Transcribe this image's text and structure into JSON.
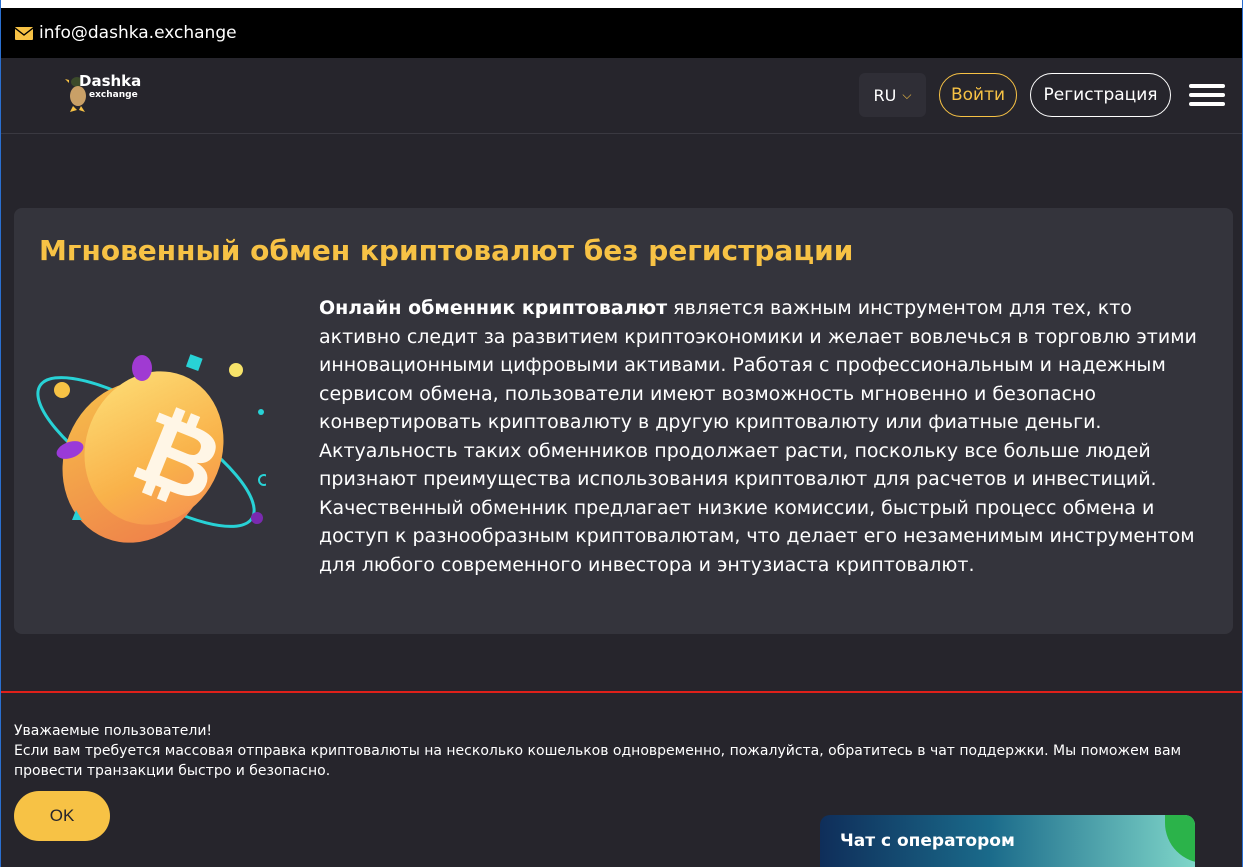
{
  "topbar": {
    "email": "info@dashka.exchange",
    "icon": "mail-icon"
  },
  "header": {
    "logo_line1": "Dashka",
    "logo_line2": "exchange",
    "lang": "RU",
    "login_label": "Войти",
    "register_label": "Регистрация"
  },
  "hero": {
    "title": "Мгновенный обмен криптовалют без регистрации",
    "lead_bold": "Онлайн обменник криптовалют",
    "body": " является важным инструментом для тех, кто активно следит за развитием криптоэкономики и желает вовлечься в торговлю этими инновационными цифровыми активами. Работая с профессиональным и надежным сервисом обмена, пользователи имеют возможность мгновенно и безопасно конвертировать криптовалюту в другую криптовалюту или фиатные деньги. Актуальность таких обменников продолжает расти, поскольку все больше людей признают преимущества использования криптовалют для расчетов и инвестиций. Качественный обменник предлагает низкие комиссии, быстрый процесс обмена и доступ к разнообразным криптовалютам, что делает его незаменимым инструментом для любого современного инвестора и энтузиаста криптовалют."
  },
  "notice": {
    "line1": "Уважаемые пользователи!",
    "line2": "Если вам требуется массовая отправка криптовалюты на несколько кошельков одновременно, пожалуйста, обратитесь в чат поддержки. Мы поможем вам провести транзакции быстро и безопасно.",
    "ok_label": "OK"
  },
  "chat": {
    "label": "Чат с оператором"
  },
  "colors": {
    "accent": "#f7c245",
    "bg": "#26252c",
    "card": "#34343c",
    "alert_line": "#e0201a"
  }
}
